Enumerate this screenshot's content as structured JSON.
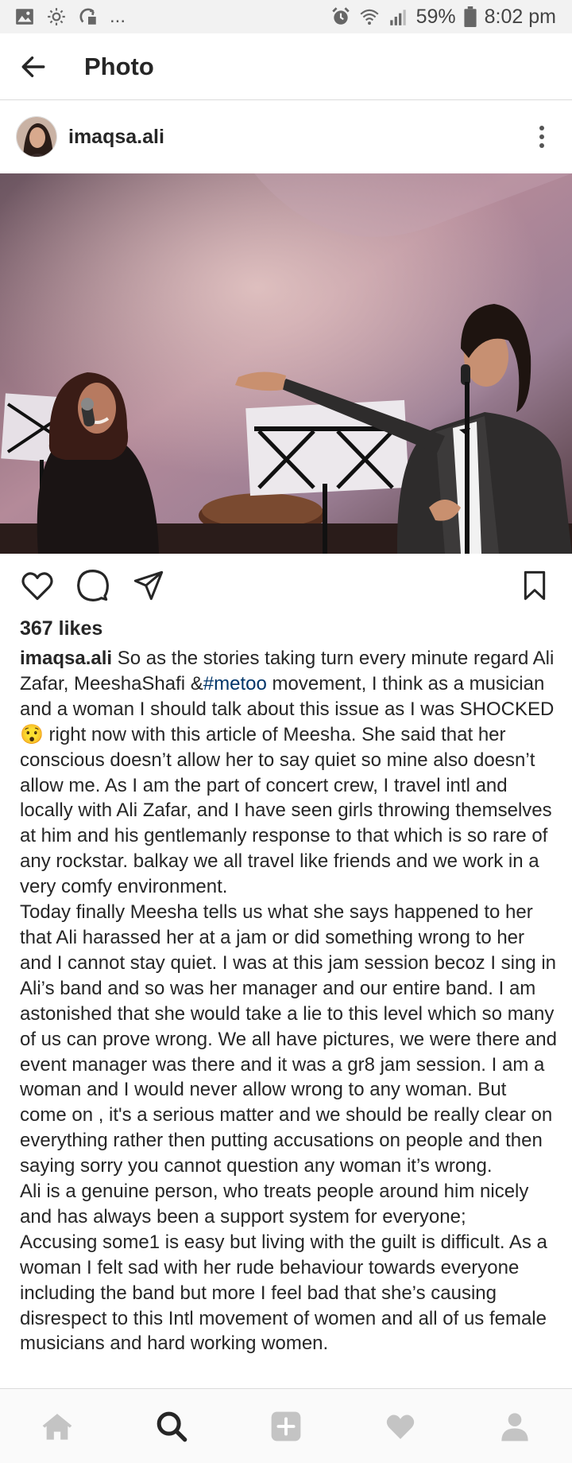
{
  "status_bar": {
    "left_icons": [
      "gallery-icon",
      "brightness-icon",
      "sync-icon"
    ],
    "overflow": "...",
    "battery_percent": "59%",
    "time": "8:02 pm"
  },
  "header": {
    "title": "Photo"
  },
  "post": {
    "username": "imaqsa.ali",
    "likes": "367 likes",
    "caption": {
      "username": "imaqsa.ali",
      "p1_before_hashtag": " So as the stories taking turn every minute regard Ali Zafar, MeeshaShafi &",
      "hashtag": "#metoo",
      "p1_before_emoji": " movement, I think as a musician and a woman I should talk about this issue as I was SHOCKED ",
      "emoji": "😯",
      "p1_after_emoji": " right now with this article of Meesha. She said that her conscious doesn’t allow her to say quiet so mine also doesn’t allow me. As I am the part of concert crew, I travel intl and locally with Ali Zafar, and I have seen girls throwing themselves at him and his gentlemanly response to that which is so rare of any rockstar.  balkay we all travel like friends and we work in a very comfy environment.",
      "p2": "Today finally Meesha tells us what she says  happened to her that Ali harassed her at a jam or did something wrong to her and I cannot stay quiet. I was at this jam session becoz I sing in Ali’s band and so was her manager and our entire band. I am astonished that she would take a lie to this level which so many of us can prove wrong. We all have pictures, we were there and event manager was there and it was a gr8 jam session. I am a woman and I would never allow wrong to any woman. But come on , it's a serious matter and we should be really clear on everything rather then putting accusations on people and then saying sorry you cannot question any woman it’s wrong.",
      "p3": "Ali is a genuine person, who treats people around him nicely and has always been a support system for everyone;",
      "p4": " Accusing some1 is easy but living with the guilt is difficult. As a woman I felt sad with her rude behaviour towards everyone including the band but more I feel bad that she’s causing disrespect to this Intl movement of women and all of us female musicians and hard working women."
    }
  },
  "bottom_nav": [
    "home-icon",
    "search-icon",
    "add-post-icon",
    "activity-icon",
    "profile-icon"
  ]
}
